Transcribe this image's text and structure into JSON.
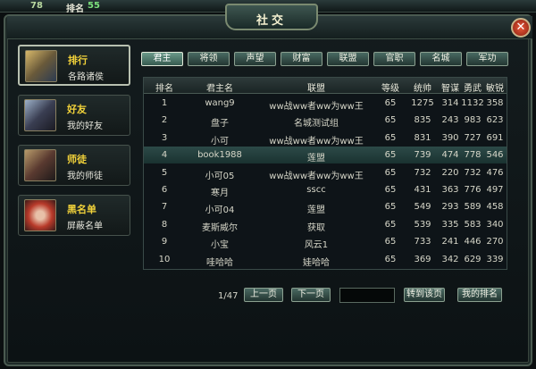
{
  "topbar": {
    "num": "78",
    "rank_label": "排名",
    "rank_value": "55"
  },
  "window": {
    "title": "社交",
    "close_symbol": "✕"
  },
  "sidebar": [
    {
      "title": "排行",
      "subtitle": "各路诸侯",
      "icon": "warrior-portrait",
      "active": true
    },
    {
      "title": "好友",
      "subtitle": "我的好友",
      "icon": "knight-portrait",
      "active": false
    },
    {
      "title": "师徒",
      "subtitle": "我的师徒",
      "icon": "mentor-portrait",
      "active": false
    },
    {
      "title": "黑名单",
      "subtitle": "屏蔽名单",
      "icon": "blacklist-portrait",
      "active": false
    }
  ],
  "tabs": [
    "君主",
    "将领",
    "声望",
    "财富",
    "联盟",
    "官职",
    "名城",
    "军功"
  ],
  "active_tab": 0,
  "table": {
    "headers": [
      "排名",
      "君主名",
      "联盟",
      "等级",
      "统帅",
      "智谋",
      "勇武",
      "敏锐"
    ],
    "rows": [
      [
        "1",
        "wang9",
        "ww战ww者ww为ww王",
        "65",
        "1275",
        "314",
        "1132",
        "358"
      ],
      [
        "2",
        "盘子",
        "名城测试组",
        "65",
        "835",
        "243",
        "983",
        "623"
      ],
      [
        "3",
        "小可",
        "ww战ww者ww为ww王",
        "65",
        "831",
        "390",
        "727",
        "691"
      ],
      [
        "4",
        "book1988",
        "莲盟",
        "65",
        "739",
        "474",
        "778",
        "546"
      ],
      [
        "5",
        "小可05",
        "ww战ww者ww为ww王",
        "65",
        "732",
        "220",
        "732",
        "476"
      ],
      [
        "6",
        "寒月",
        "sscc",
        "65",
        "431",
        "363",
        "776",
        "497"
      ],
      [
        "7",
        "小可04",
        "莲盟",
        "65",
        "549",
        "293",
        "589",
        "458"
      ],
      [
        "8",
        "麦斯威尔",
        "获取",
        "65",
        "539",
        "335",
        "583",
        "340"
      ],
      [
        "9",
        "小宝",
        "风云1",
        "65",
        "733",
        "241",
        "446",
        "270"
      ],
      [
        "10",
        "哇哈哈",
        "娃哈哈",
        "65",
        "369",
        "342",
        "629",
        "339"
      ]
    ],
    "selected_row": 3
  },
  "footer": {
    "page_info": "1/47",
    "prev_label": "上一页",
    "next_label": "下一页",
    "page_input_value": "",
    "goto_label": "转到该页",
    "my_rank_label": "我的排名"
  },
  "colors": {
    "accent_gold": "#f2d23a",
    "panel_bg": "#0e1418",
    "border": "#8ba090",
    "rank_green": "#7ce07c"
  }
}
